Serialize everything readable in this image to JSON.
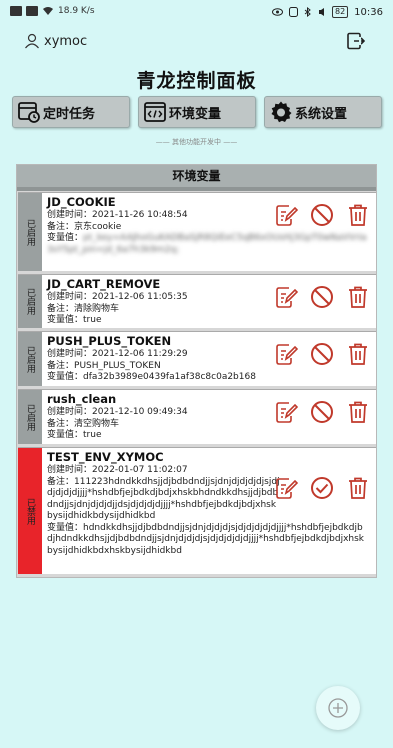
{
  "status_bar": {
    "left_text": "18.9 K/s",
    "time": "10:36",
    "battery": "82"
  },
  "user": {
    "name": "xymoc"
  },
  "title": "青龙控制面板",
  "nav": [
    {
      "label": "定时任务",
      "icon": "clock-calendar-icon"
    },
    {
      "label": "环境变量",
      "icon": "code-window-icon"
    },
    {
      "label": "系统设置",
      "icon": "gear-icon"
    }
  ],
  "dev_note": "—— 其他功能开发中 ——",
  "panel": {
    "header": "环境变量"
  },
  "labels": {
    "created": "创建时间：",
    "remark": "备注：",
    "value": "变量值："
  },
  "envs": [
    {
      "status": "已启用",
      "name": "JD_COOKIE",
      "created": "2021-11-26 10:48:54",
      "remark": "京东cookie",
      "value": "pt_key=AAJhoGuKADBaSjR8QiEeC5qB6xOUsHj3GpT0wNaVVrIa3sY5pt_pin=jd_6a7h3k9m2q;"
    },
    {
      "status": "已启用",
      "name": "JD_CART_REMOVE",
      "created": "2021-12-06 11:05:35",
      "remark": "清除购物车",
      "value": "true"
    },
    {
      "status": "已启用",
      "name": "PUSH_PLUS_TOKEN",
      "created": "2021-12-06 11:29:29",
      "remark": "PUSH_PLUS_TOKEN",
      "value": "dfa32b3989e0439fa1af38c8c0a2b168"
    },
    {
      "status": "已启用",
      "name": "rush_clean",
      "created": "2021-12-10 09:49:34",
      "remark": "清空购物车",
      "value": "true"
    },
    {
      "status": "已禁用",
      "name": "TEST_ENV_XYMOC",
      "created": "2022-01-07 11:02:07",
      "remark": "111223hdndkkdhsjjdjbdbdndjjsjdnjdjdjdjdjsjdjdjdjdjdjjjj*hshdbfjejbdkdjbdjxhskbhdndkkdhsjjdjbdbdndjjsjdnjdjdjdjjdsjdjdjdjdjjjj*hshdbfjejbdkdjbdjxhskbysijdhidkbdysijdhidkbd",
      "value": "hdndkkdhsjjdjbdbdndjjsjdnjdjdjdjsjdjdjdjdjdjjjj*hshdbfjejbdkdjbdjhdndkkdhsjjdjbdbdndjjsjdnjdjdjdjsjdjdjdjdjdjjjj*hshdbfjejbdkdjbdjxhskbysijdhidkbdxhskbysijdhidkbd"
    }
  ],
  "colors": {
    "background": "#d6f7f6",
    "action_red": "#c0392b",
    "disabled_red": "#e8242a"
  }
}
